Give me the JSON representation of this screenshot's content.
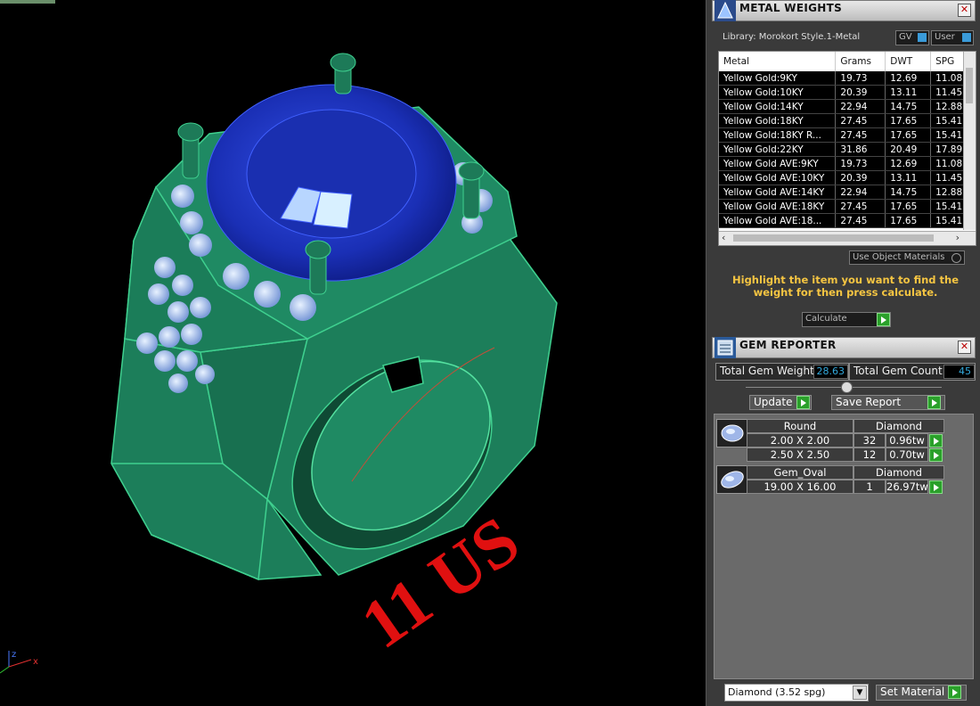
{
  "viewport": {
    "ring_size_label": "11 US",
    "axis_labels": {
      "z": "z",
      "x": "x"
    }
  },
  "metal_weights": {
    "title": "METAL WEIGHTS",
    "library_label": "Library: Morokort Style.1-Metal",
    "toggle_gv": "GV",
    "toggle_user": "User",
    "columns": [
      "Metal",
      "Grams",
      "DWT",
      "SPG"
    ],
    "rows": [
      [
        "Yellow Gold:9KY",
        "19.73",
        "12.69",
        "11.08"
      ],
      [
        "Yellow Gold:10KY",
        "20.39",
        "13.11",
        "11.45"
      ],
      [
        "Yellow Gold:14KY",
        "22.94",
        "14.75",
        "12.88"
      ],
      [
        "Yellow Gold:18KY",
        "27.45",
        "17.65",
        "15.41"
      ],
      [
        "Yellow Gold:18KY R...",
        "27.45",
        "17.65",
        "15.41"
      ],
      [
        "Yellow Gold:22KY",
        "31.86",
        "20.49",
        "17.89"
      ],
      [
        "Yellow Gold AVE:9KY",
        "19.73",
        "12.69",
        "11.08"
      ],
      [
        "Yellow Gold AVE:10KY",
        "20.39",
        "13.11",
        "11.45"
      ],
      [
        "Yellow Gold AVE:14KY",
        "22.94",
        "14.75",
        "12.88"
      ],
      [
        "Yellow Gold AVE:18KY",
        "27.45",
        "17.65",
        "15.41"
      ],
      [
        "Yellow Gold AVE:18...",
        "27.45",
        "17.65",
        "15.41"
      ]
    ],
    "use_object_materials": "Use Object Materials",
    "hint": "Highlight the item you want to find the weight for then press calculate.",
    "calculate_select": "Calculate"
  },
  "gem_reporter": {
    "title": "GEM REPORTER",
    "total_weight_label": "Total Gem Weight",
    "total_weight_value": "28.63",
    "total_count_label": "Total Gem Count",
    "total_count_value": "45",
    "update_label": "Update",
    "save_report_label": "Save Report",
    "groups": [
      {
        "shape": "Round",
        "material": "Diamond",
        "rows": [
          {
            "size": "2.00 X 2.00",
            "count": "32",
            "weight": "0.96tw"
          },
          {
            "size": "2.50 X 2.50",
            "count": "12",
            "weight": "0.70tw"
          }
        ]
      },
      {
        "shape": "Gem_Oval",
        "material": "Diamond",
        "rows": [
          {
            "size": "19.00 X 16.00",
            "count": "1",
            "weight": "26.97tw"
          }
        ]
      }
    ],
    "material_select": "Diamond     (3.52 spg)",
    "set_material_label": "Set Material"
  },
  "colors": {
    "ring": "#1f8a63",
    "center_gem": "#1e35c8",
    "label_red": "#e01010",
    "hint_yellow": "#f5c542"
  }
}
